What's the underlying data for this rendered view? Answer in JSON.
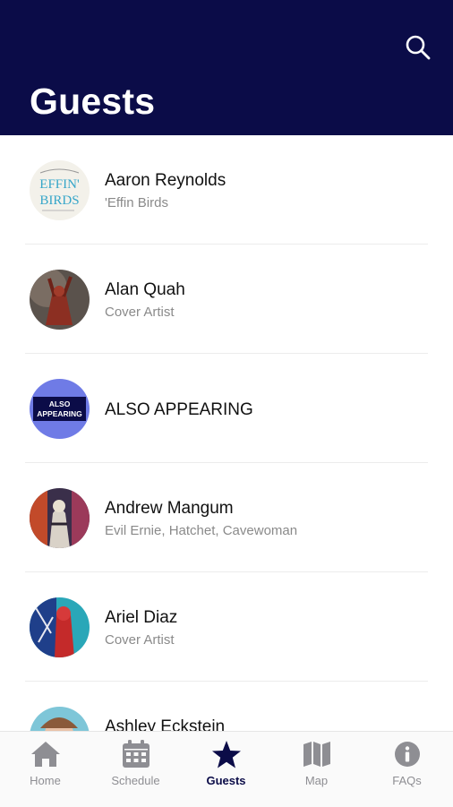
{
  "header": {
    "title": "Guests",
    "background": "#0b0c48",
    "search_icon": "search-icon"
  },
  "guests": [
    {
      "name": "Aaron Reynolds",
      "subtitle": "'Effin Birds",
      "avatar_text": [
        "EFFIN'",
        "BIRDS"
      ]
    },
    {
      "name": "Alan Quah",
      "subtitle": "Cover Artist"
    },
    {
      "name": "ALSO APPEARING",
      "subtitle": "",
      "avatar_text": [
        "ALSO",
        "APPEARING"
      ]
    },
    {
      "name": "Andrew Mangum",
      "subtitle": "Evil Ernie, Hatchet, Cavewoman"
    },
    {
      "name": "Ariel Diaz",
      "subtitle": "Cover Artist"
    },
    {
      "name": "Ashley Eckstein",
      "subtitle": ""
    }
  ],
  "tabbar": {
    "active": "Guests",
    "active_color": "#0b0c48",
    "inactive_color": "#8e8e93",
    "tabs": [
      {
        "label": "Home",
        "icon": "home-icon"
      },
      {
        "label": "Schedule",
        "icon": "calendar-icon"
      },
      {
        "label": "Guests",
        "icon": "star-icon"
      },
      {
        "label": "Map",
        "icon": "map-icon"
      },
      {
        "label": "FAQs",
        "icon": "info-icon"
      }
    ]
  }
}
